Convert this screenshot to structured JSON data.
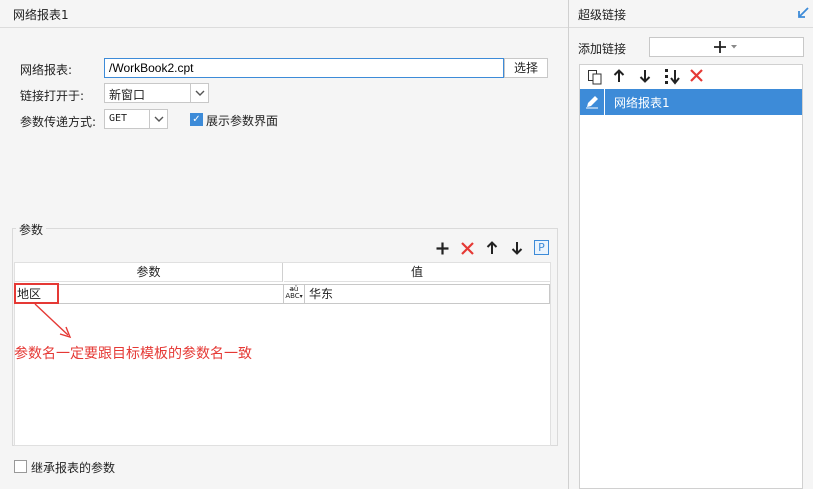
{
  "left": {
    "title": "网络报表1",
    "report_label": "网络报表:",
    "report_path": "/WorkBook2.cpt",
    "choose_button": "选择",
    "open_label": "链接打开于:",
    "open_value": "新窗口",
    "pass_label": "参数传递方式:",
    "pass_value": "GET",
    "show_params_label": "展示参数界面",
    "show_params_checked": true,
    "params_group_title": "参数",
    "table": {
      "headers": [
        "参数",
        "值"
      ],
      "rows": [
        {
          "name": "地区",
          "value": "华东"
        }
      ]
    },
    "annotation": "参数名一定要跟目标模板的参数名一致",
    "inherit_label": "继承报表的参数"
  },
  "right": {
    "title": "超级链接",
    "add_label": "添加链接",
    "items": [
      {
        "label": "网络报表1"
      }
    ]
  },
  "colors": {
    "accent": "#3d8bd8",
    "danger": "#e53935",
    "annotation": "#e53935"
  }
}
